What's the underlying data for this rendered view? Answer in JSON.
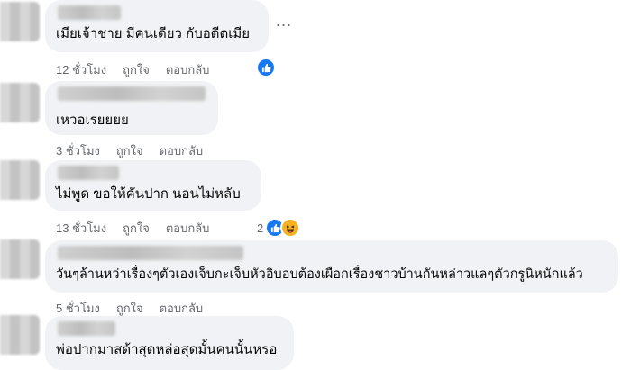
{
  "colors": {
    "bubble": "#f0f2f5",
    "meta_text": "#65676b",
    "like_blue": "#1877f2",
    "haha_yellow": "#f7b125"
  },
  "more_menu_label": "...",
  "comments": [
    {
      "text": "เมียเจ้าชาย มีคนเดียว กับอดีตเมีย",
      "time": "12 ชั่วโมง",
      "like": "ถูกใจ",
      "reply": "ตอบกลับ",
      "reactions": {
        "icons": [
          "like-icon"
        ],
        "count": ""
      }
    },
    {
      "text": "เหวอเรยยยย",
      "time": "3 ชั่วโมง",
      "like": "ถูกใจ",
      "reply": "ตอบกลับ"
    },
    {
      "text": "ไม่พูด ขอให้คันปาก นอนไม่หลับ",
      "time": "13 ชั่วโมง",
      "like": "ถูกใจ",
      "reply": "ตอบกลับ",
      "reactions": {
        "icons": [
          "like-icon",
          "haha-icon"
        ],
        "count": "2"
      }
    },
    {
      "text": "วันๆล้านหว่าเรื่องๆตัวเองเจ็บกะเจ็บหัวอิบอบต้องเผือกเรื่องชาวบ้านกันหล่าวแลๆตัวกรูนิหนักแล้ว",
      "time": "5 ชั่วโมง",
      "like": "ถูกใจ",
      "reply": "ตอบกลับ"
    },
    {
      "text": "พ่อปากมาสด้าสุดหล่อสุดมั้นคนนั้นหรอ"
    }
  ]
}
